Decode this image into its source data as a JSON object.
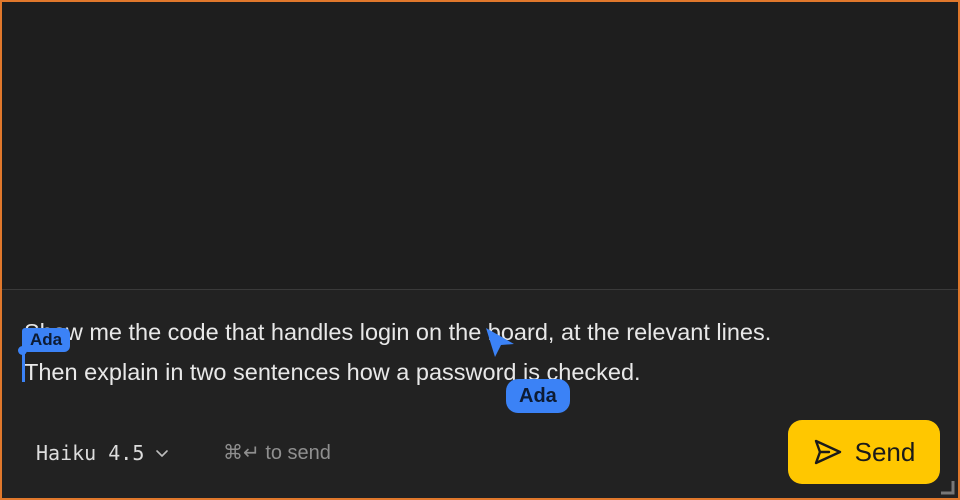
{
  "composer": {
    "prompt_line_1": "Show me the code that handles login on the board, at the relevant lines.",
    "prompt_line_2": "Then explain in two sentences how a password is checked.",
    "cursor_tag_label": "Ada",
    "pointer_tag_label": "Ada"
  },
  "toolbar": {
    "model_label": "Haiku 4.5",
    "send_hint": "⌘↵ to send",
    "send_label": "Send"
  },
  "icons": {
    "model_dropdown": "chevron-down-icon",
    "send": "send-arrow-icon",
    "pointer": "cursor-pointer-icon",
    "resize": "resize-handle-icon"
  },
  "colors": {
    "frame_border": "#e0782c",
    "background": "#1e1e1e",
    "collaborator_accent": "#3b82f6",
    "send_button": "#ffc700"
  }
}
